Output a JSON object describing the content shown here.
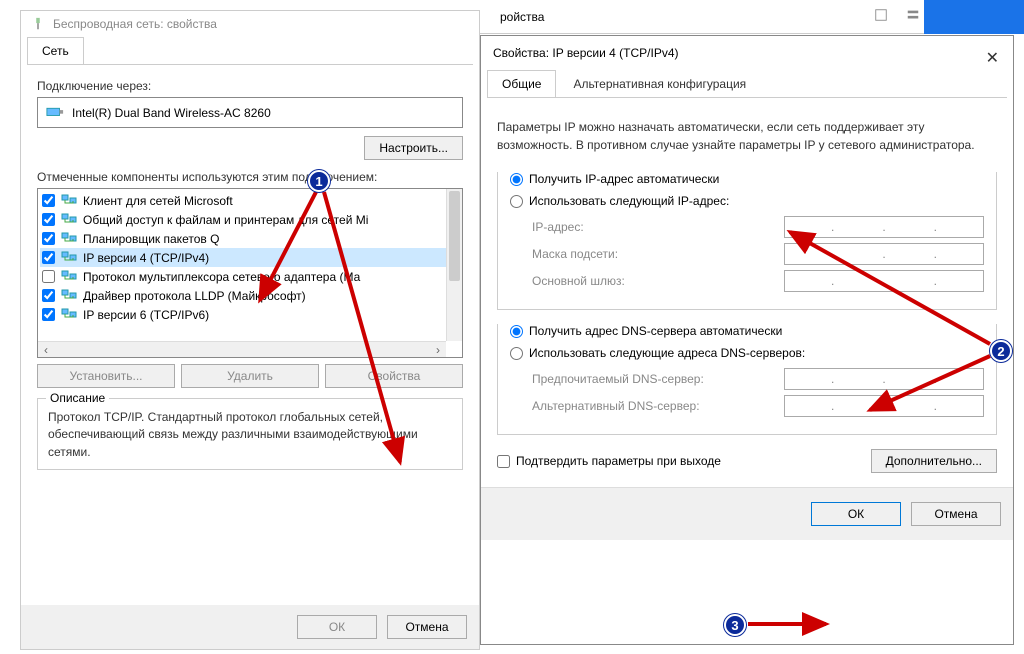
{
  "top_fragment": {
    "text": "ройства"
  },
  "left": {
    "title": "Беспроводная сеть: свойства",
    "tab": "Сеть",
    "connect_via_label": "Подключение через:",
    "adapter": "Intel(R) Dual Band Wireless-AC 8260",
    "configure_btn": "Настроить...",
    "components_label": "Отмеченные компоненты используются этим подключением:",
    "components": [
      {
        "checked": true,
        "label": "Клиент для сетей Microsoft"
      },
      {
        "checked": true,
        "label": "Общий доступ к файлам и принтерам для сетей Mi"
      },
      {
        "checked": true,
        "label": "Планировщик пакетов Q"
      },
      {
        "checked": true,
        "label": "IP версии 4 (TCP/IPv4)"
      },
      {
        "checked": false,
        "label": "Протокол мультиплексора сетевого адаптера (Ма"
      },
      {
        "checked": true,
        "label": "Драйвер протокола LLDP (Майкрософт)"
      },
      {
        "checked": true,
        "label": "IP версии 6 (TCP/IPv6)"
      }
    ],
    "install_btn": "Установить...",
    "remove_btn": "Удалить",
    "props_btn": "Свойства",
    "desc_title": "Описание",
    "desc_text": "Протокол TCP/IP. Стандартный протокол глобальных сетей, обеспечивающий связь между различными взаимодействующими сетями.",
    "ok": "ОК",
    "cancel": "Отмена"
  },
  "right": {
    "title": "Свойства: IP версии 4 (TCP/IPv4)",
    "tab1": "Общие",
    "tab2": "Альтернативная конфигурация",
    "desc": "Параметры IP можно назначать автоматически, если сеть поддерживает эту возможность. В противном случае узнайте параметры IP у сетевого администратора.",
    "radio_ip_auto": "Получить IP-адрес автоматически",
    "radio_ip_manual": "Использовать следующий IP-адрес:",
    "ip_label": "IP-адрес:",
    "mask_label": "Маска подсети:",
    "gw_label": "Основной шлюз:",
    "radio_dns_auto": "Получить адрес DNS-сервера автоматически",
    "radio_dns_manual": "Использовать следующие адреса DNS-серверов:",
    "dns1_label": "Предпочитаемый DNS-сервер:",
    "dns2_label": "Альтернативный DNS-сервер:",
    "confirm_exit": "Подтвердить параметры при выходе",
    "advanced_btn": "Дополнительно...",
    "ok": "ОК",
    "cancel": "Отмена"
  },
  "markers": {
    "m1": "1",
    "m2": "2",
    "m3": "3"
  }
}
